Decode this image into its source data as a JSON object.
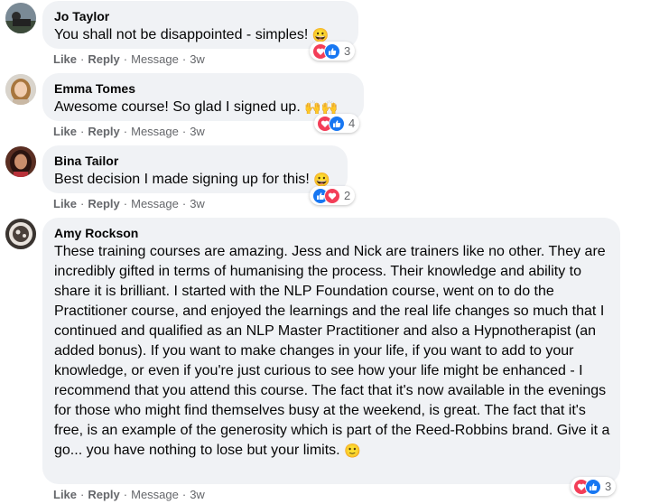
{
  "comments": [
    {
      "author": "Jo Taylor",
      "text": "You shall not be disappointed - simples!",
      "emoji": "😀",
      "reaction_count": "3",
      "actions": {
        "like": "Like",
        "reply": "Reply",
        "message": "Message",
        "time": "3w"
      }
    },
    {
      "author": "Emma Tomes",
      "text": "Awesome course! So glad I signed up.",
      "emoji": "🙌🙌",
      "reaction_count": "4",
      "actions": {
        "like": "Like",
        "reply": "Reply",
        "message": "Message",
        "time": "3w"
      }
    },
    {
      "author": "Bina Tailor",
      "text": "Best decision I made signing up for this!",
      "emoji": "😀",
      "reaction_count": "2",
      "actions": {
        "like": "Like",
        "reply": "Reply",
        "message": "Message",
        "time": "3w"
      }
    },
    {
      "author": "Amy Rockson",
      "text": "These training courses are amazing. Jess and Nick are trainers like no other. They are incredibly gifted in terms of humanising the process. Their knowledge and ability to share it is brilliant. I started with the NLP Foundation course, went on to do the Practitioner course, and enjoyed the learnings and the real life changes so much that I continued and qualified as an NLP Master Practitioner and also a Hypnotherapist (an added bonus). If you want to make changes in your life, if you want to add to your knowledge, or even if you're just curious to see how your life might be enhanced - I recommend that you attend this course. The fact that it's now available in the evenings for those who might find themselves busy at the weekend, is great. The fact that it's free, is an example of the generosity which is part of the Reed-Robbins brand. Give it a go... you have nothing to lose but your limits.",
      "emoji": "🙂",
      "reaction_count": "3",
      "actions": {
        "like": "Like",
        "reply": "Reply",
        "message": "Message",
        "time": "3w"
      }
    }
  ],
  "colors": {
    "bubble": "#f0f2f5",
    "like": "#1877f2",
    "heart": "#f33e58",
    "meta": "#65676b"
  }
}
